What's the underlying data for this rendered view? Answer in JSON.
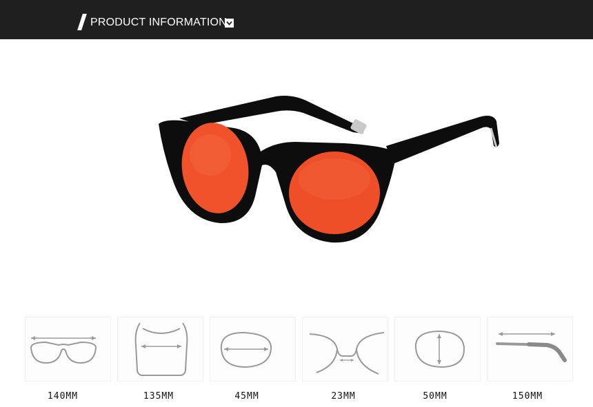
{
  "header": {
    "title": "PRODUCT INFORMATION",
    "background": "#1f1f1f",
    "chevron_icon": "chevron-down-icon"
  },
  "product": {
    "frame_color": "#0d0d0d",
    "lens_color": "#f0532c"
  },
  "measurements": [
    {
      "icon": "frame-width-icon",
      "value": "140MM"
    },
    {
      "icon": "frame-height-icon",
      "value": "135MM"
    },
    {
      "icon": "lens-width-icon",
      "value": "45MM"
    },
    {
      "icon": "bridge-width-icon",
      "value": "23MM"
    },
    {
      "icon": "lens-height-icon",
      "value": "50MM"
    },
    {
      "icon": "temple-length-icon",
      "value": "150MM"
    }
  ]
}
